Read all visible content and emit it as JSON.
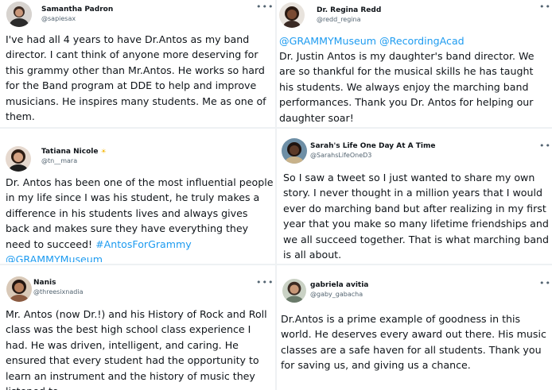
{
  "tweets": [
    {
      "name": "Samantha Padron",
      "handle": "@sapiesax",
      "text": "I've had all 4 years to have Dr.Antos as my band director. I cant think of anyone more deserving for this grammy other than Mr.Antos. He works so hard for the Band program at DDE to help and improve musicians. He inspires many students. Me as one of them."
    },
    {
      "name": "Dr. Regina Redd",
      "handle": "@redd_regina",
      "links": "@GRAMMYMuseum @RecordingAcad",
      "text": "Dr. Justin Antos is my daughter's band director.  We are so thankful for the musical skills he has taught his students. We always enjoy the marching band performances. Thank you Dr. Antos for helping our daughter soar!"
    },
    {
      "name": "Tatiana Nicole",
      "handle": "@tn__mara",
      "text": "Dr. Antos has been one of the most influential people in my life since I was his student, he truly makes a difference in his students lives and always gives back and makes sure they have everything they need to succeed!",
      "links": "#AntosForGrammy @GRAMMYMuseum"
    },
    {
      "name": "Sarah's Life One Day At A Time",
      "handle": "@SarahsLifeOneD3",
      "text": "So I saw a tweet so I just wanted to share my own story. I never thought in a million years that I would ever do marching band but after realizing in my first year that you make so many lifetime friendships and we all succeed together. That is what marching band is all about."
    },
    {
      "name": "Nanis",
      "handle": "@threesixnadia",
      "text": "Mr. Antos (now Dr.!) and his History of Rock and Roll class was the best high school class experience I had. He was driven, intelligent, and caring. He ensured that every student had the opportunity to learn an instrument and the history of music they listened to."
    },
    {
      "name": "gabriela avitia",
      "handle": "@gaby_gabacha",
      "text": "Dr.Antos is a prime example of goodness in this world. He deserves every award out there. His music classes are a safe haven for all students. Thank you for saving us, and giving us a chance."
    }
  ],
  "more_glyph": "•••",
  "colors": {
    "link": "#1d9bf0",
    "text": "#0f1419",
    "handle": "#536471"
  }
}
